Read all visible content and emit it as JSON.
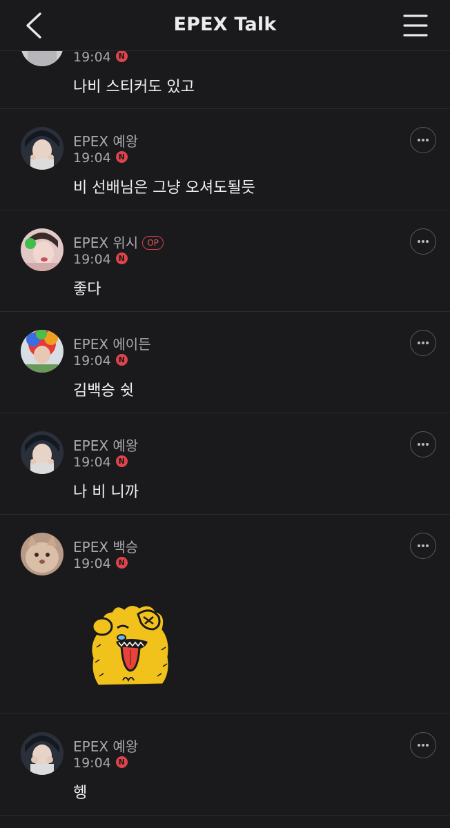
{
  "header": {
    "title": "EPEX Talk",
    "back_icon": "chevron-left-icon",
    "menu_icon": "hamburger-menu-icon"
  },
  "comments": [
    {
      "name": "",
      "time": "19:04",
      "text": "나비 스티커도 있고",
      "badge": "N"
    },
    {
      "name": "EPEX 예왕",
      "time": "19:04",
      "text": "비 선배님은 그냥 오셔도될듯",
      "badge": "N"
    },
    {
      "name": "EPEX 위시",
      "op": "OP",
      "time": "19:04",
      "text": "좋다",
      "badge": "N"
    },
    {
      "name": "EPEX 에이든",
      "time": "19:04",
      "text": "김백승 쉿",
      "badge": "N"
    },
    {
      "name": "EPEX 예왕",
      "time": "19:04",
      "text": "나 비 니까",
      "badge": "N"
    },
    {
      "name": "EPEX 백승",
      "time": "19:04",
      "text": "",
      "badge": "N",
      "sticker": "tongue-out-bear-sticker"
    },
    {
      "name": "EPEX 예왕",
      "time": "19:04",
      "text": "헹",
      "badge": "N"
    }
  ],
  "colors": {
    "background": "#1a1a1c",
    "divider": "#2b2b2f",
    "meta_text": "#a9a9ae",
    "accent_red": "#e0444b"
  }
}
